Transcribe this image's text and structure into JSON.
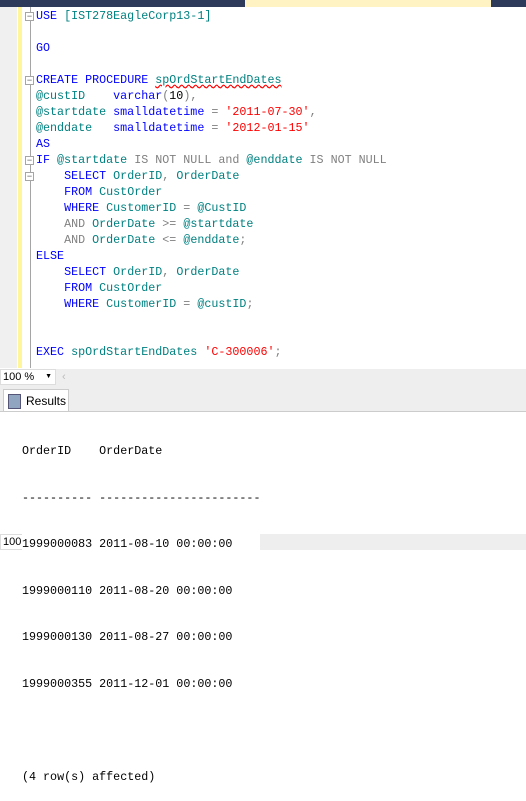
{
  "editor": {
    "lines": [
      [
        [
          "USE",
          "kw"
        ],
        [
          " ",
          "tx"
        ],
        [
          "[IST278EagleCorp13-1]",
          "id"
        ]
      ],
      [],
      [
        [
          "GO",
          "kw"
        ]
      ],
      [],
      [
        [
          "CREATE",
          "kw"
        ],
        [
          " ",
          "tx"
        ],
        [
          "PROCEDURE",
          "kw"
        ],
        [
          " ",
          "tx"
        ],
        [
          "spOrdStartEndDates",
          "id sq"
        ]
      ],
      [
        [
          "@custID",
          "id"
        ],
        [
          "    ",
          "tx"
        ],
        [
          "varchar",
          "kw"
        ],
        [
          "(",
          "op"
        ],
        [
          "10",
          "tx"
        ],
        [
          "),",
          "op"
        ]
      ],
      [
        [
          "@startdate",
          "id"
        ],
        [
          " ",
          "tx"
        ],
        [
          "smalldatetime",
          "kw"
        ],
        [
          " = ",
          "op"
        ],
        [
          "'2011-07-30'",
          "str"
        ],
        [
          ",",
          "op"
        ]
      ],
      [
        [
          "@enddate",
          "id"
        ],
        [
          "   ",
          "tx"
        ],
        [
          "smalldatetime",
          "kw"
        ],
        [
          " = ",
          "op"
        ],
        [
          "'2012-01-15'",
          "str"
        ]
      ],
      [
        [
          "AS",
          "kw"
        ]
      ],
      [
        [
          "IF",
          "kw"
        ],
        [
          " ",
          "tx"
        ],
        [
          "@startdate",
          "id"
        ],
        [
          " IS NOT NULL and ",
          "op"
        ],
        [
          "@enddate",
          "id"
        ],
        [
          " IS NOT NULL",
          "op"
        ]
      ],
      [
        [
          "    ",
          "tx"
        ],
        [
          "SELECT",
          "kw"
        ],
        [
          " ",
          "tx"
        ],
        [
          "OrderID",
          "id"
        ],
        [
          ", ",
          "op"
        ],
        [
          "OrderDate",
          "id"
        ]
      ],
      [
        [
          "    ",
          "tx"
        ],
        [
          "FROM",
          "kw"
        ],
        [
          " ",
          "tx"
        ],
        [
          "CustOrder",
          "id"
        ]
      ],
      [
        [
          "    ",
          "tx"
        ],
        [
          "WHERE",
          "kw"
        ],
        [
          " ",
          "tx"
        ],
        [
          "CustomerID",
          "id"
        ],
        [
          " = ",
          "op"
        ],
        [
          "@CustID",
          "id"
        ]
      ],
      [
        [
          "    ",
          "tx"
        ],
        [
          "AND",
          "op"
        ],
        [
          " ",
          "tx"
        ],
        [
          "OrderDate",
          "id"
        ],
        [
          " >= ",
          "op"
        ],
        [
          "@startdate",
          "id"
        ]
      ],
      [
        [
          "    ",
          "tx"
        ],
        [
          "AND",
          "op"
        ],
        [
          " ",
          "tx"
        ],
        [
          "OrderDate",
          "id"
        ],
        [
          " <= ",
          "op"
        ],
        [
          "@enddate",
          "id"
        ],
        [
          ";",
          "op"
        ]
      ],
      [
        [
          "ELSE",
          "kw"
        ]
      ],
      [
        [
          "    ",
          "tx"
        ],
        [
          "SELECT",
          "kw"
        ],
        [
          " ",
          "tx"
        ],
        [
          "OrderID",
          "id"
        ],
        [
          ", ",
          "op"
        ],
        [
          "OrderDate",
          "id"
        ]
      ],
      [
        [
          "    ",
          "tx"
        ],
        [
          "FROM",
          "kw"
        ],
        [
          " ",
          "tx"
        ],
        [
          "CustOrder",
          "id"
        ]
      ],
      [
        [
          "    ",
          "tx"
        ],
        [
          "WHERE",
          "kw"
        ],
        [
          " ",
          "tx"
        ],
        [
          "CustomerID",
          "id"
        ],
        [
          " = ",
          "op"
        ],
        [
          "@custID",
          "id"
        ],
        [
          ";",
          "op"
        ]
      ],
      [],
      [],
      [
        [
          "EXEC",
          "kw"
        ],
        [
          " ",
          "tx"
        ],
        [
          "spOrdStartEndDates",
          "id"
        ],
        [
          " ",
          "tx"
        ],
        [
          "'C-300006'",
          "str"
        ],
        [
          ";",
          "op"
        ]
      ]
    ]
  },
  "zoom": {
    "value": "100 %"
  },
  "results_tab": {
    "label": "Results"
  },
  "results": {
    "header": "OrderID    OrderDate",
    "separator": "---------- -----------------------",
    "rows": [
      "1999000083 2011-08-10 00:00:00",
      "1999000110 2011-08-20 00:00:00",
      "1999000130 2011-08-27 00:00:00",
      "1999000355 2011-12-01 00:00:00"
    ],
    "footer": "(4 row(s) affected)"
  }
}
